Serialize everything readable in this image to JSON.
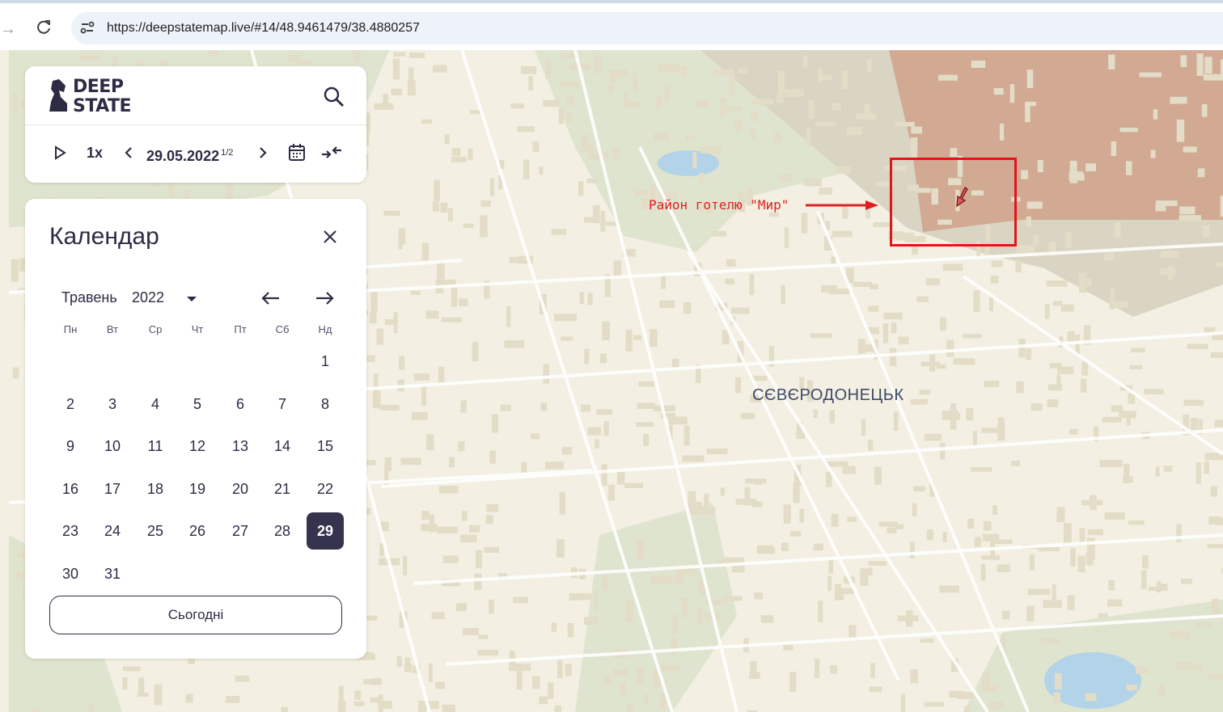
{
  "browser": {
    "url": "https://deepstatemap.live/#14/48.9461479/38.4880257"
  },
  "header": {
    "logo": {
      "line1": "DEEP",
      "line2": "STATE"
    },
    "speed": "1x",
    "date": "29.05.2022",
    "date_fraction": "1/2"
  },
  "calendar": {
    "title": "Календар",
    "month": "Травень",
    "year": "2022",
    "weekdays": [
      "Пн",
      "Вт",
      "Ср",
      "Чт",
      "Пт",
      "Сб",
      "Нд"
    ],
    "days": [
      "1",
      "2",
      "3",
      "4",
      "5",
      "6",
      "7",
      "8",
      "9",
      "10",
      "11",
      "12",
      "13",
      "14",
      "15",
      "16",
      "17",
      "18",
      "19",
      "20",
      "21",
      "22",
      "23",
      "24",
      "25",
      "26",
      "27",
      "28",
      "29",
      "30",
      "31"
    ],
    "selected_day": "29",
    "today_label": "Сьогодні"
  },
  "map": {
    "city_label": "СЄВЄРОДОНЕЦЬК",
    "annotation": "Район готелю \"Мир\""
  },
  "colors": {
    "accent": "#35334d",
    "highlight": "#e5141c",
    "occupied_area": "#d2a993",
    "map_land": "#f3efe2"
  }
}
